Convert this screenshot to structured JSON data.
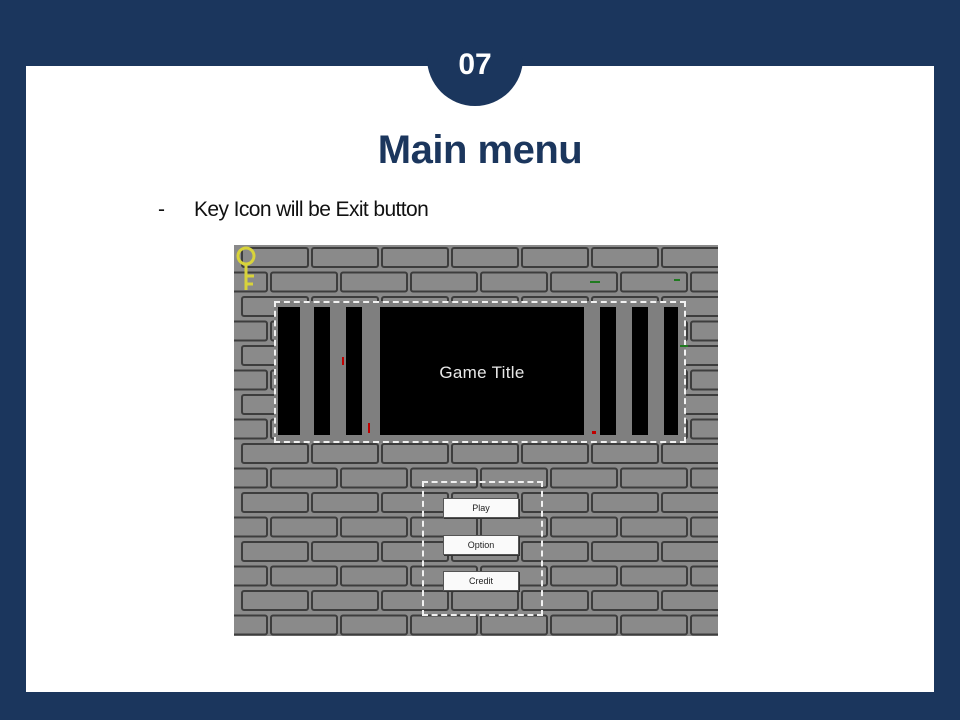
{
  "slide": {
    "number": "07",
    "title": "Main menu",
    "bullet": {
      "marker": "-",
      "text": "Key Icon will be Exit button"
    }
  },
  "game": {
    "title": "Game Title",
    "menu": {
      "play_label": "Play",
      "option_label": "Option",
      "credit_label": "Credit"
    },
    "exit_icon": "key-icon",
    "colors": {
      "brick": "#8a8a8a",
      "mortar": "#3d3d3d",
      "frame": "#f1f1f1",
      "key": "#d8d33a",
      "accent_red": "#c00000",
      "accent_green": "#1f7a1f"
    }
  }
}
